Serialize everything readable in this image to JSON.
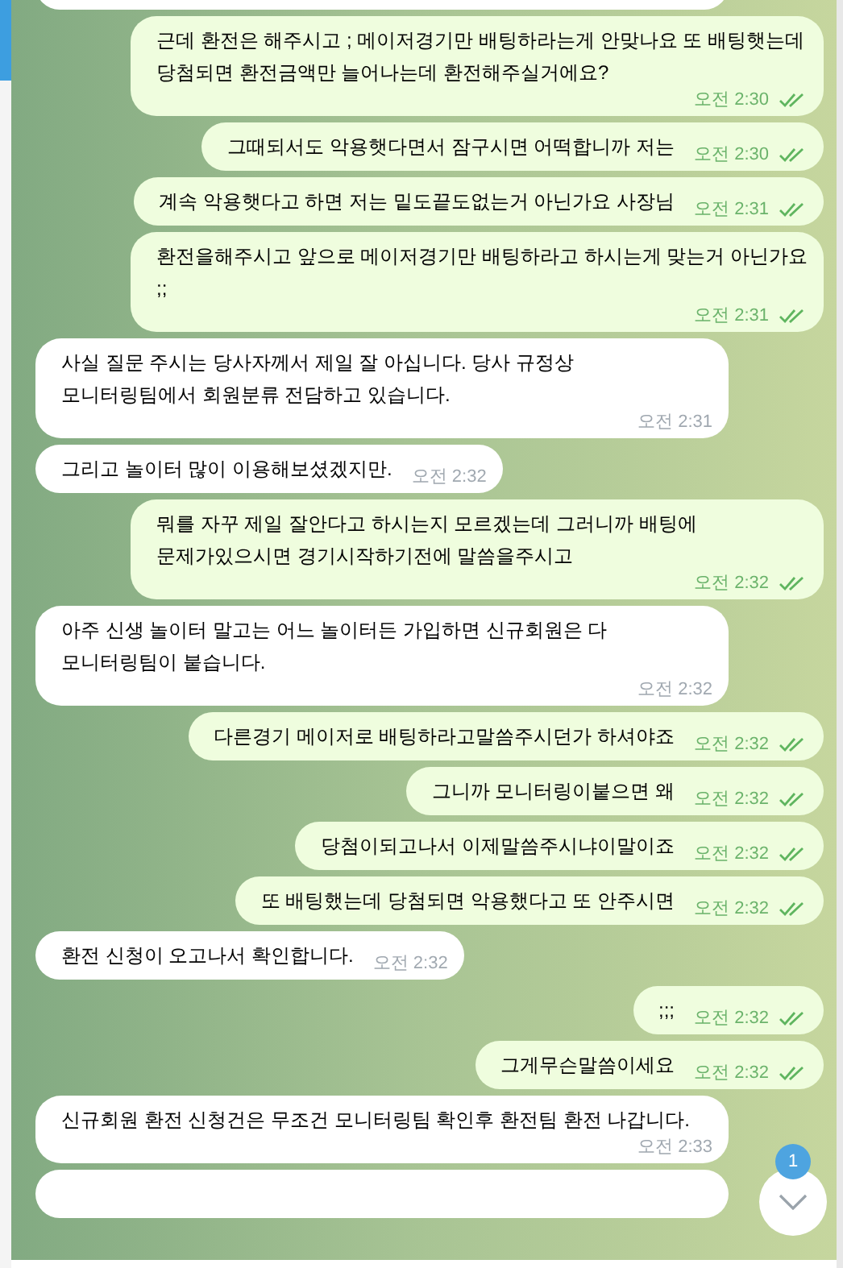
{
  "messages": [
    {
      "kind": "in_partial"
    },
    {
      "kind": "out",
      "text": "근데 환전은 해주시고 ; 메이저경기만 배팅하라는게 안맞나요 또 배팅햇는데 당첨되면 환전금액만 늘어나는데 환전해주실거에요?",
      "time": "오전 2:30",
      "read": true
    },
    {
      "kind": "out",
      "text": "그때되서도 악용햇다면서 잠구시면 어떡합니까 저는",
      "time": "오전 2:30",
      "read": true
    },
    {
      "kind": "out",
      "text": "계속 악용햇다고 하면 저는 밑도끝도없는거 아닌가요 사장님",
      "time": "오전 2:31",
      "read": true
    },
    {
      "kind": "out",
      "text": "환전을해주시고 앞으로 메이저경기만 배팅하라고 하시는게 맞는거 아닌가요 ;;",
      "time": "오전 2:31",
      "read": true
    },
    {
      "kind": "in",
      "text": "사실 질문 주시는 당사자께서 제일 잘 아십니다. 당사 규정상 모니터링팀에서 회원분류 전담하고 있습니다.",
      "time": "오전 2:31"
    },
    {
      "kind": "in",
      "text": "그리고 놀이터 많이 이용해보셨겠지만.",
      "time": "오전 2:32"
    },
    {
      "kind": "out",
      "text": "뭐를 자꾸 제일 잘안다고 하시는지 모르겠는데 그러니까 배팅에 문제가있으시면 경기시작하기전에 말씀을주시고",
      "time": "오전 2:32",
      "read": true
    },
    {
      "kind": "in",
      "text": "아주 신생 놀이터 말고는 어느 놀이터든 가입하면 신규회원은 다 모니터링팀이 붙습니다.",
      "time": "오전 2:32"
    },
    {
      "kind": "out",
      "text": "다른경기 메이저로 배팅하라고말씀주시던가 하셔야죠",
      "time": "오전 2:32",
      "read": true
    },
    {
      "kind": "out",
      "text": "그니까 모니터링이붙으면 왜",
      "time": "오전 2:32",
      "read": true
    },
    {
      "kind": "out",
      "text": "당첨이되고나서 이제말씀주시냐이말이죠",
      "time": "오전 2:32",
      "read": true
    },
    {
      "kind": "out",
      "text": "또 배팅했는데 당첨되면 악용했다고 또 안주시면",
      "time": "오전 2:32",
      "read": true
    },
    {
      "kind": "in",
      "text": "환전 신청이 오고나서 확인합니다.",
      "time": "오전 2:32"
    },
    {
      "kind": "out",
      "text": ";;;",
      "time": "오전 2:32",
      "read": true
    },
    {
      "kind": "out",
      "text": "그게무슨말씀이세요",
      "time": "오전 2:32",
      "read": true
    },
    {
      "kind": "in",
      "text": "신규회원 환전 신청건은 무조건 모니터링팀 확인후 환전팀 환전 나갑니다.",
      "time": "오전 2:33"
    },
    {
      "kind": "in_partial"
    }
  ],
  "scroll_button": {
    "badge": "1"
  }
}
